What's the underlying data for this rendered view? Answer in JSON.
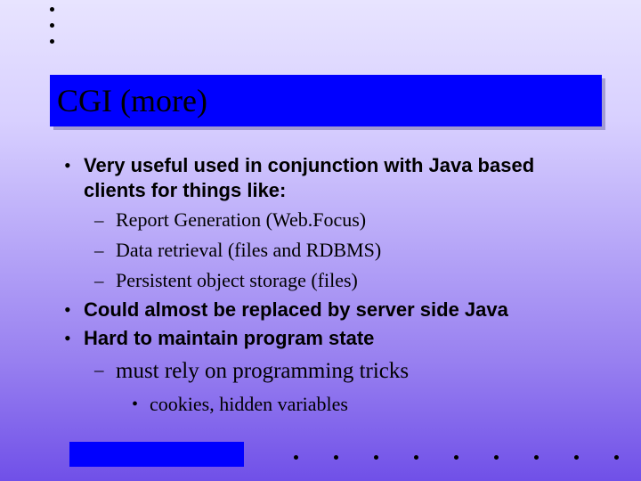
{
  "title": "CGI (more)",
  "bullets": {
    "b1_1": "Very useful used in conjunction with Java based clients for things like:",
    "b2_1": "Report Generation (Web.Focus)",
    "b2_2": "Data retrieval (files and RDBMS)",
    "b2_3": "Persistent object storage (files)",
    "b1_2": "Could almost be replaced by server side Java",
    "b1_3": "Hard to maintain program state",
    "b2_4": "must rely on programming tricks",
    "b3_1": "cookies, hidden variables"
  }
}
